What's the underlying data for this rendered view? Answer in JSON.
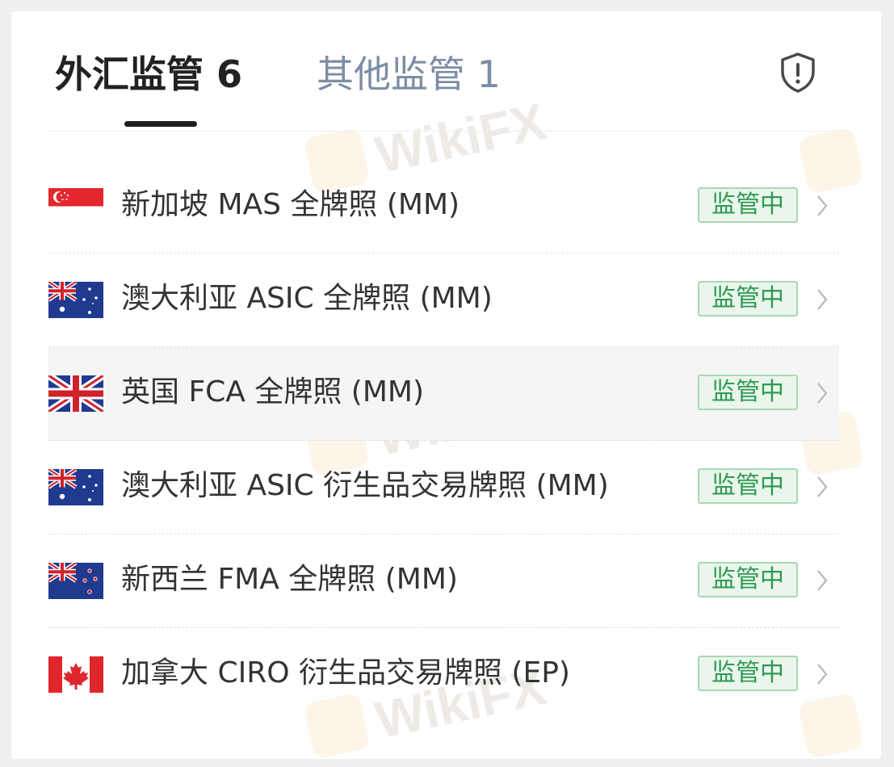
{
  "tabs": {
    "active_label": "外汇监管 6",
    "inactive_label": "其他监管 1"
  },
  "icons": {
    "shield": "shield-alert-icon",
    "chevron": "chevron-right-icon"
  },
  "colors": {
    "active_tab": "#222222",
    "inactive_tab": "#7d8da3",
    "badge_text": "#2e9a52",
    "badge_bg": "#eaf6ec",
    "badge_border": "#a9d8b4"
  },
  "regulations": [
    {
      "flag": "singapore-flag-icon",
      "label": "新加坡 MAS 全牌照 (MM)",
      "status": "监管中"
    },
    {
      "flag": "australia-flag-icon",
      "label": "澳大利亚 ASIC 全牌照 (MM)",
      "status": "监管中"
    },
    {
      "flag": "united-kingdom-flag-icon",
      "label": "英国 FCA 全牌照 (MM)",
      "status": "监管中"
    },
    {
      "flag": "australia-flag-icon",
      "label": "澳大利亚 ASIC 衍生品交易牌照 (MM)",
      "status": "监管中"
    },
    {
      "flag": "new-zealand-flag-icon",
      "label": "新西兰 FMA 全牌照 (MM)",
      "status": "监管中"
    },
    {
      "flag": "canada-flag-icon",
      "label": "加拿大 CIRO 衍生品交易牌照 (EP)",
      "status": "监管中"
    }
  ],
  "watermark": {
    "text": "WikiFX"
  }
}
